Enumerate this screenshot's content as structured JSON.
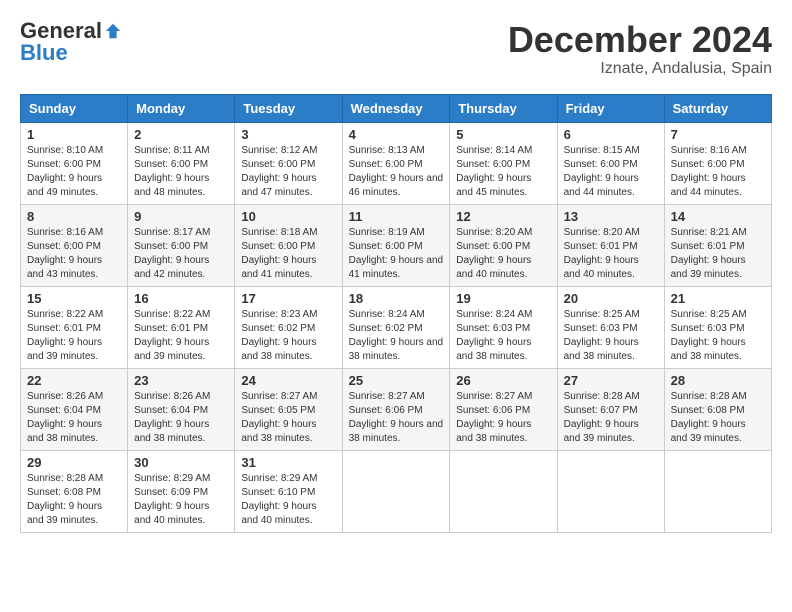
{
  "logo": {
    "general": "General",
    "blue": "Blue"
  },
  "title": "December 2024",
  "subtitle": "Iznate, Andalusia, Spain",
  "headers": [
    "Sunday",
    "Monday",
    "Tuesday",
    "Wednesday",
    "Thursday",
    "Friday",
    "Saturday"
  ],
  "weeks": [
    [
      {
        "day": "1",
        "sunrise": "8:10 AM",
        "sunset": "6:00 PM",
        "daylight": "9 hours and 49 minutes."
      },
      {
        "day": "2",
        "sunrise": "8:11 AM",
        "sunset": "6:00 PM",
        "daylight": "9 hours and 48 minutes."
      },
      {
        "day": "3",
        "sunrise": "8:12 AM",
        "sunset": "6:00 PM",
        "daylight": "9 hours and 47 minutes."
      },
      {
        "day": "4",
        "sunrise": "8:13 AM",
        "sunset": "6:00 PM",
        "daylight": "9 hours and 46 minutes."
      },
      {
        "day": "5",
        "sunrise": "8:14 AM",
        "sunset": "6:00 PM",
        "daylight": "9 hours and 45 minutes."
      },
      {
        "day": "6",
        "sunrise": "8:15 AM",
        "sunset": "6:00 PM",
        "daylight": "9 hours and 44 minutes."
      },
      {
        "day": "7",
        "sunrise": "8:16 AM",
        "sunset": "6:00 PM",
        "daylight": "9 hours and 44 minutes."
      }
    ],
    [
      {
        "day": "8",
        "sunrise": "8:16 AM",
        "sunset": "6:00 PM",
        "daylight": "9 hours and 43 minutes."
      },
      {
        "day": "9",
        "sunrise": "8:17 AM",
        "sunset": "6:00 PM",
        "daylight": "9 hours and 42 minutes."
      },
      {
        "day": "10",
        "sunrise": "8:18 AM",
        "sunset": "6:00 PM",
        "daylight": "9 hours and 41 minutes."
      },
      {
        "day": "11",
        "sunrise": "8:19 AM",
        "sunset": "6:00 PM",
        "daylight": "9 hours and 41 minutes."
      },
      {
        "day": "12",
        "sunrise": "8:20 AM",
        "sunset": "6:00 PM",
        "daylight": "9 hours and 40 minutes."
      },
      {
        "day": "13",
        "sunrise": "8:20 AM",
        "sunset": "6:01 PM",
        "daylight": "9 hours and 40 minutes."
      },
      {
        "day": "14",
        "sunrise": "8:21 AM",
        "sunset": "6:01 PM",
        "daylight": "9 hours and 39 minutes."
      }
    ],
    [
      {
        "day": "15",
        "sunrise": "8:22 AM",
        "sunset": "6:01 PM",
        "daylight": "9 hours and 39 minutes."
      },
      {
        "day": "16",
        "sunrise": "8:22 AM",
        "sunset": "6:01 PM",
        "daylight": "9 hours and 39 minutes."
      },
      {
        "day": "17",
        "sunrise": "8:23 AM",
        "sunset": "6:02 PM",
        "daylight": "9 hours and 38 minutes."
      },
      {
        "day": "18",
        "sunrise": "8:24 AM",
        "sunset": "6:02 PM",
        "daylight": "9 hours and 38 minutes."
      },
      {
        "day": "19",
        "sunrise": "8:24 AM",
        "sunset": "6:03 PM",
        "daylight": "9 hours and 38 minutes."
      },
      {
        "day": "20",
        "sunrise": "8:25 AM",
        "sunset": "6:03 PM",
        "daylight": "9 hours and 38 minutes."
      },
      {
        "day": "21",
        "sunrise": "8:25 AM",
        "sunset": "6:03 PM",
        "daylight": "9 hours and 38 minutes."
      }
    ],
    [
      {
        "day": "22",
        "sunrise": "8:26 AM",
        "sunset": "6:04 PM",
        "daylight": "9 hours and 38 minutes."
      },
      {
        "day": "23",
        "sunrise": "8:26 AM",
        "sunset": "6:04 PM",
        "daylight": "9 hours and 38 minutes."
      },
      {
        "day": "24",
        "sunrise": "8:27 AM",
        "sunset": "6:05 PM",
        "daylight": "9 hours and 38 minutes."
      },
      {
        "day": "25",
        "sunrise": "8:27 AM",
        "sunset": "6:06 PM",
        "daylight": "9 hours and 38 minutes."
      },
      {
        "day": "26",
        "sunrise": "8:27 AM",
        "sunset": "6:06 PM",
        "daylight": "9 hours and 38 minutes."
      },
      {
        "day": "27",
        "sunrise": "8:28 AM",
        "sunset": "6:07 PM",
        "daylight": "9 hours and 39 minutes."
      },
      {
        "day": "28",
        "sunrise": "8:28 AM",
        "sunset": "6:08 PM",
        "daylight": "9 hours and 39 minutes."
      }
    ],
    [
      {
        "day": "29",
        "sunrise": "8:28 AM",
        "sunset": "6:08 PM",
        "daylight": "9 hours and 39 minutes."
      },
      {
        "day": "30",
        "sunrise": "8:29 AM",
        "sunset": "6:09 PM",
        "daylight": "9 hours and 40 minutes."
      },
      {
        "day": "31",
        "sunrise": "8:29 AM",
        "sunset": "6:10 PM",
        "daylight": "9 hours and 40 minutes."
      },
      null,
      null,
      null,
      null
    ]
  ],
  "labels": {
    "sunrise": "Sunrise:",
    "sunset": "Sunset:",
    "daylight": "Daylight:"
  }
}
